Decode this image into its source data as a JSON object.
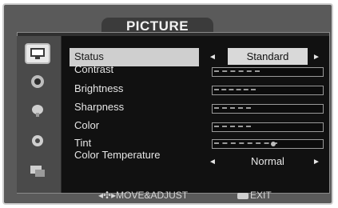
{
  "window": {
    "title": "PICTURE"
  },
  "sidebar": {
    "items": [
      {
        "name": "picture",
        "icon": "monitor-icon",
        "selected": true
      },
      {
        "name": "sound",
        "icon": "speaker-icon",
        "selected": false
      },
      {
        "name": "channel",
        "icon": "satellite-icon",
        "selected": false
      },
      {
        "name": "setup",
        "icon": "gear-icon",
        "selected": false
      },
      {
        "name": "input",
        "icon": "input-icon",
        "selected": false
      }
    ]
  },
  "menu": {
    "status": {
      "label": "Status",
      "value": "Standard",
      "left": "◄",
      "right": "►"
    },
    "rows": [
      {
        "label": "Contrast",
        "level": 0.42
      },
      {
        "label": "Brightness",
        "level": 0.38
      },
      {
        "label": "Sharpness",
        "level": 0.34
      },
      {
        "label": "Color",
        "level": 0.34
      },
      {
        "label": "Tint",
        "level": 0.58,
        "thumb": 0.54
      }
    ],
    "color_temperature": {
      "label": "Color Temperature",
      "value": "Normal",
      "left": "◄",
      "right": "►"
    }
  },
  "footer": {
    "move_adjust": "MOVE&ADJUST",
    "exit": "EXIT"
  },
  "colors": {
    "bezel": "#5a5a5a",
    "panel": "#111111",
    "highlight": "#cfcfcf"
  }
}
